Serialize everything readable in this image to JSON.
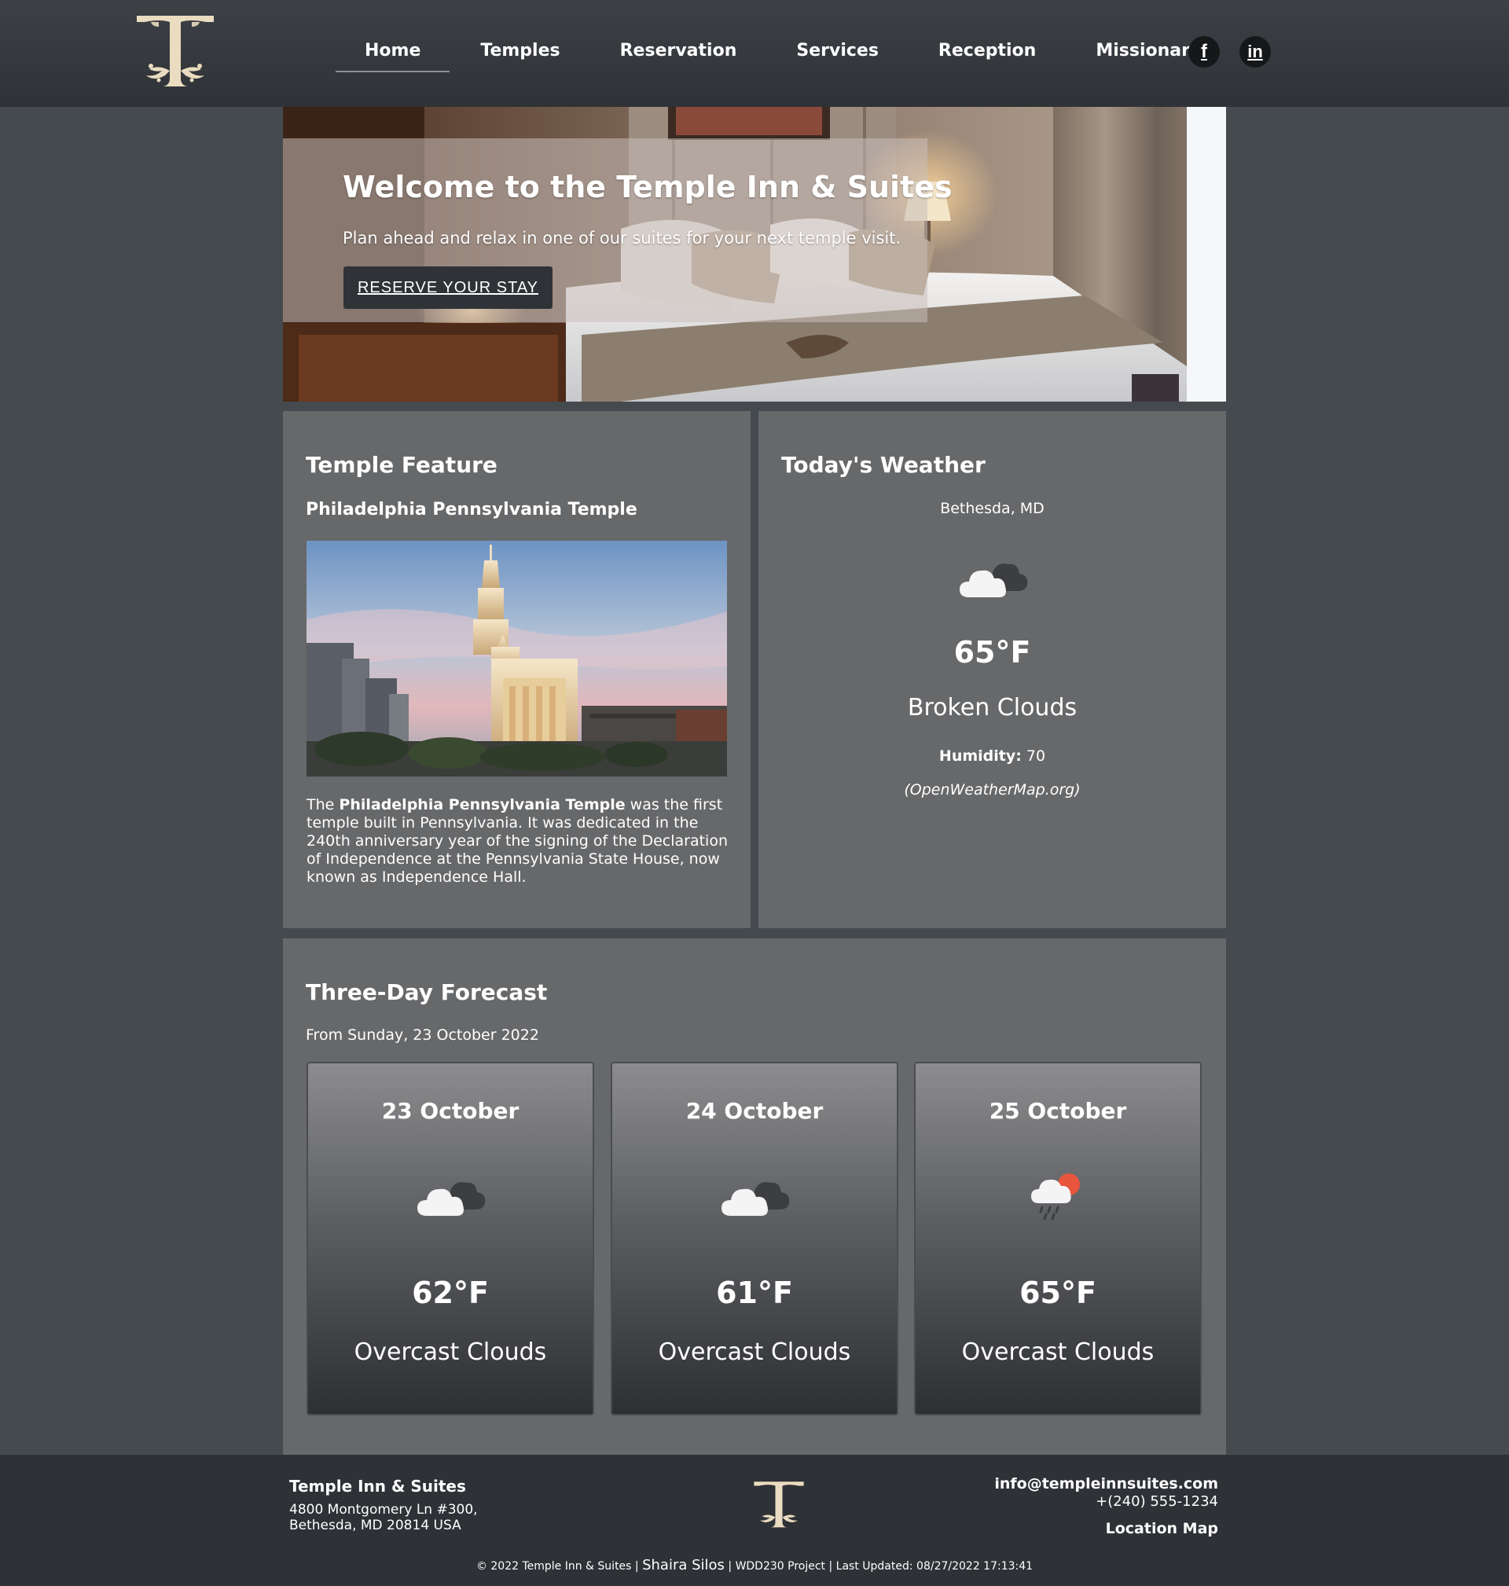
{
  "nav": {
    "items": [
      {
        "label": "Home",
        "active": true
      },
      {
        "label": "Temples"
      },
      {
        "label": "Reservation"
      },
      {
        "label": "Services"
      },
      {
        "label": "Reception"
      },
      {
        "label": "Missionaries"
      }
    ],
    "social": [
      {
        "icon": "facebook-icon",
        "glyph": "f"
      },
      {
        "icon": "linkedin-icon",
        "glyph": "in"
      }
    ]
  },
  "hero": {
    "title": "Welcome to the Temple Inn & Suites",
    "subtitle": "Plan ahead and relax in one of our suites for your next temple visit.",
    "button_label": "RESERVE YOUR STAY"
  },
  "feature": {
    "heading": "Temple Feature",
    "temple_name": "Philadelphia Pennsylvania Temple",
    "text_before": "The ",
    "text_bold": "Philadelphia Pennsylvania Temple",
    "text_after": " was the first temple built in Pennsylvania. It was dedicated in the 240th anniversary year of the signing of the Declaration of Independence at the Pennsylvania State House, now known as Independence Hall."
  },
  "weather": {
    "heading": "Today's Weather",
    "location": "Bethesda, MD",
    "icon": "broken-clouds-icon",
    "temp": "65°F",
    "description": "Broken Clouds",
    "humidity_label": "Humidity:",
    "humidity_value": " 70",
    "source": "(OpenWeatherMap.org)"
  },
  "forecast": {
    "heading": "Three-Day Forecast",
    "from": "From Sunday, 23 October 2022",
    "days": [
      {
        "date": "23 October",
        "icon": "cloud-icon",
        "temp": "62°F",
        "desc": "Overcast Clouds"
      },
      {
        "date": "24 October",
        "icon": "cloud-icon",
        "temp": "61°F",
        "desc": "Overcast Clouds"
      },
      {
        "date": "25 October",
        "icon": "rain-sun-cloud-icon",
        "temp": "65°F",
        "desc": "Overcast Clouds"
      }
    ]
  },
  "footer": {
    "name": "Temple Inn & Suites",
    "address_line1": "4800 Montgomery Ln #300,",
    "address_line2": "Bethesda, MD 20814 USA",
    "email": "info@templeinnsuites.com",
    "phone": "+(240) 555-1234",
    "map_link": "Location Map",
    "copyright": "© 2022  Temple Inn & Suites",
    "author": "Shaira Silos",
    "project": "WDD230 Project",
    "last_updated": "Last Updated: 08/27/2022 17:13:41"
  },
  "colors": {
    "page_bg": "#454a4f",
    "card_bg": "#67686a",
    "header_bg": "#3d4146",
    "footer_bg": "#2e3135",
    "logo_gold": "#eadcc0",
    "button_bg": "#2f3337"
  }
}
